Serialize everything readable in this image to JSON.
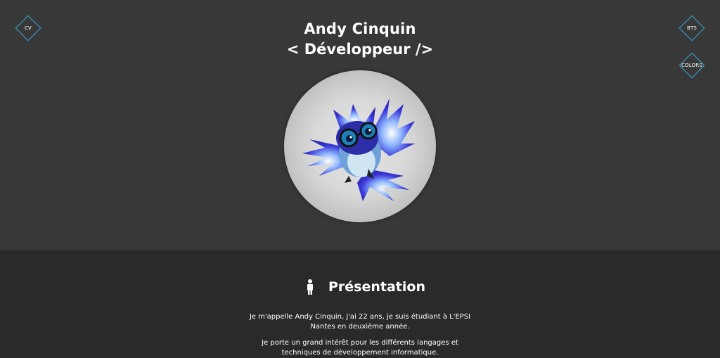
{
  "nav": {
    "cv_label": "CV",
    "bts_label": "BTS",
    "colors_label": "COLORS"
  },
  "header": {
    "name": "Andy Cinquin",
    "role": "< Développeur />"
  },
  "avatar": {
    "icon": "owl-mascot-with-glasses"
  },
  "presentation": {
    "title": "Présentation",
    "icon": "person-icon",
    "paragraph1": "Je m'appelle Andy Cinquin, j'ai 22 ans, je suis étudiant à L'EPSI Nantes en deuxième année.",
    "paragraph2": "Je porte un grand intérêt pour les différents langages et techniques de développement informatique."
  },
  "colors": {
    "accent": "#3aa7d8",
    "hero_bg": "#383838",
    "section_bg": "#2a2a2a"
  }
}
